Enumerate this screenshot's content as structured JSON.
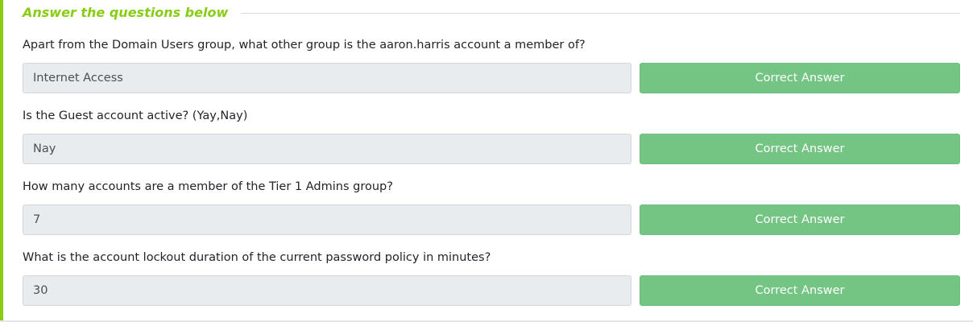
{
  "header": {
    "title": "Answer the questions below"
  },
  "colors": {
    "accent": "#88cc14",
    "button_bg": "#74c584",
    "field_bg": "#e9ecef"
  },
  "questions": [
    {
      "question": "Apart from the Domain Users group, what other group is the aaron.harris account a member of?",
      "answer": "Internet Access",
      "button_label": "Correct Answer"
    },
    {
      "question": "Is the Guest account active? (Yay,Nay)",
      "answer": "Nay",
      "button_label": "Correct Answer"
    },
    {
      "question": "How many accounts are a member of the Tier 1 Admins group?",
      "answer": "7",
      "button_label": "Correct Answer"
    },
    {
      "question": "What is the account lockout duration of the current password policy in minutes?",
      "answer": "30",
      "button_label": "Correct Answer"
    }
  ]
}
